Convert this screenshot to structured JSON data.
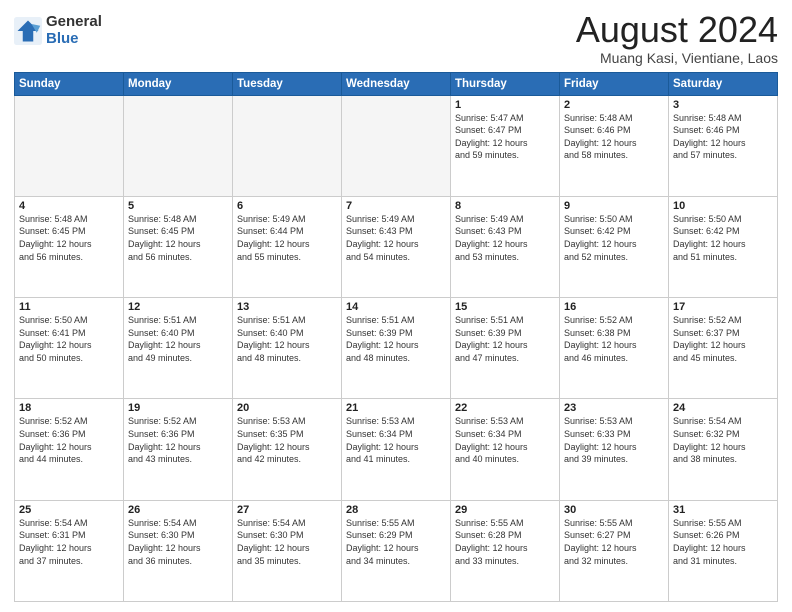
{
  "logo": {
    "general": "General",
    "blue": "Blue"
  },
  "title": "August 2024",
  "subtitle": "Muang Kasi, Vientiane, Laos",
  "days_of_week": [
    "Sunday",
    "Monday",
    "Tuesday",
    "Wednesday",
    "Thursday",
    "Friday",
    "Saturday"
  ],
  "weeks": [
    [
      {
        "day": "",
        "info": ""
      },
      {
        "day": "",
        "info": ""
      },
      {
        "day": "",
        "info": ""
      },
      {
        "day": "",
        "info": ""
      },
      {
        "day": "1",
        "info": "Sunrise: 5:47 AM\nSunset: 6:47 PM\nDaylight: 12 hours\nand 59 minutes."
      },
      {
        "day": "2",
        "info": "Sunrise: 5:48 AM\nSunset: 6:46 PM\nDaylight: 12 hours\nand 58 minutes."
      },
      {
        "day": "3",
        "info": "Sunrise: 5:48 AM\nSunset: 6:46 PM\nDaylight: 12 hours\nand 57 minutes."
      }
    ],
    [
      {
        "day": "4",
        "info": "Sunrise: 5:48 AM\nSunset: 6:45 PM\nDaylight: 12 hours\nand 56 minutes."
      },
      {
        "day": "5",
        "info": "Sunrise: 5:48 AM\nSunset: 6:45 PM\nDaylight: 12 hours\nand 56 minutes."
      },
      {
        "day": "6",
        "info": "Sunrise: 5:49 AM\nSunset: 6:44 PM\nDaylight: 12 hours\nand 55 minutes."
      },
      {
        "day": "7",
        "info": "Sunrise: 5:49 AM\nSunset: 6:43 PM\nDaylight: 12 hours\nand 54 minutes."
      },
      {
        "day": "8",
        "info": "Sunrise: 5:49 AM\nSunset: 6:43 PM\nDaylight: 12 hours\nand 53 minutes."
      },
      {
        "day": "9",
        "info": "Sunrise: 5:50 AM\nSunset: 6:42 PM\nDaylight: 12 hours\nand 52 minutes."
      },
      {
        "day": "10",
        "info": "Sunrise: 5:50 AM\nSunset: 6:42 PM\nDaylight: 12 hours\nand 51 minutes."
      }
    ],
    [
      {
        "day": "11",
        "info": "Sunrise: 5:50 AM\nSunset: 6:41 PM\nDaylight: 12 hours\nand 50 minutes."
      },
      {
        "day": "12",
        "info": "Sunrise: 5:51 AM\nSunset: 6:40 PM\nDaylight: 12 hours\nand 49 minutes."
      },
      {
        "day": "13",
        "info": "Sunrise: 5:51 AM\nSunset: 6:40 PM\nDaylight: 12 hours\nand 48 minutes."
      },
      {
        "day": "14",
        "info": "Sunrise: 5:51 AM\nSunset: 6:39 PM\nDaylight: 12 hours\nand 48 minutes."
      },
      {
        "day": "15",
        "info": "Sunrise: 5:51 AM\nSunset: 6:39 PM\nDaylight: 12 hours\nand 47 minutes."
      },
      {
        "day": "16",
        "info": "Sunrise: 5:52 AM\nSunset: 6:38 PM\nDaylight: 12 hours\nand 46 minutes."
      },
      {
        "day": "17",
        "info": "Sunrise: 5:52 AM\nSunset: 6:37 PM\nDaylight: 12 hours\nand 45 minutes."
      }
    ],
    [
      {
        "day": "18",
        "info": "Sunrise: 5:52 AM\nSunset: 6:36 PM\nDaylight: 12 hours\nand 44 minutes."
      },
      {
        "day": "19",
        "info": "Sunrise: 5:52 AM\nSunset: 6:36 PM\nDaylight: 12 hours\nand 43 minutes."
      },
      {
        "day": "20",
        "info": "Sunrise: 5:53 AM\nSunset: 6:35 PM\nDaylight: 12 hours\nand 42 minutes."
      },
      {
        "day": "21",
        "info": "Sunrise: 5:53 AM\nSunset: 6:34 PM\nDaylight: 12 hours\nand 41 minutes."
      },
      {
        "day": "22",
        "info": "Sunrise: 5:53 AM\nSunset: 6:34 PM\nDaylight: 12 hours\nand 40 minutes."
      },
      {
        "day": "23",
        "info": "Sunrise: 5:53 AM\nSunset: 6:33 PM\nDaylight: 12 hours\nand 39 minutes."
      },
      {
        "day": "24",
        "info": "Sunrise: 5:54 AM\nSunset: 6:32 PM\nDaylight: 12 hours\nand 38 minutes."
      }
    ],
    [
      {
        "day": "25",
        "info": "Sunrise: 5:54 AM\nSunset: 6:31 PM\nDaylight: 12 hours\nand 37 minutes."
      },
      {
        "day": "26",
        "info": "Sunrise: 5:54 AM\nSunset: 6:30 PM\nDaylight: 12 hours\nand 36 minutes."
      },
      {
        "day": "27",
        "info": "Sunrise: 5:54 AM\nSunset: 6:30 PM\nDaylight: 12 hours\nand 35 minutes."
      },
      {
        "day": "28",
        "info": "Sunrise: 5:55 AM\nSunset: 6:29 PM\nDaylight: 12 hours\nand 34 minutes."
      },
      {
        "day": "29",
        "info": "Sunrise: 5:55 AM\nSunset: 6:28 PM\nDaylight: 12 hours\nand 33 minutes."
      },
      {
        "day": "30",
        "info": "Sunrise: 5:55 AM\nSunset: 6:27 PM\nDaylight: 12 hours\nand 32 minutes."
      },
      {
        "day": "31",
        "info": "Sunrise: 5:55 AM\nSunset: 6:26 PM\nDaylight: 12 hours\nand 31 minutes."
      }
    ]
  ]
}
